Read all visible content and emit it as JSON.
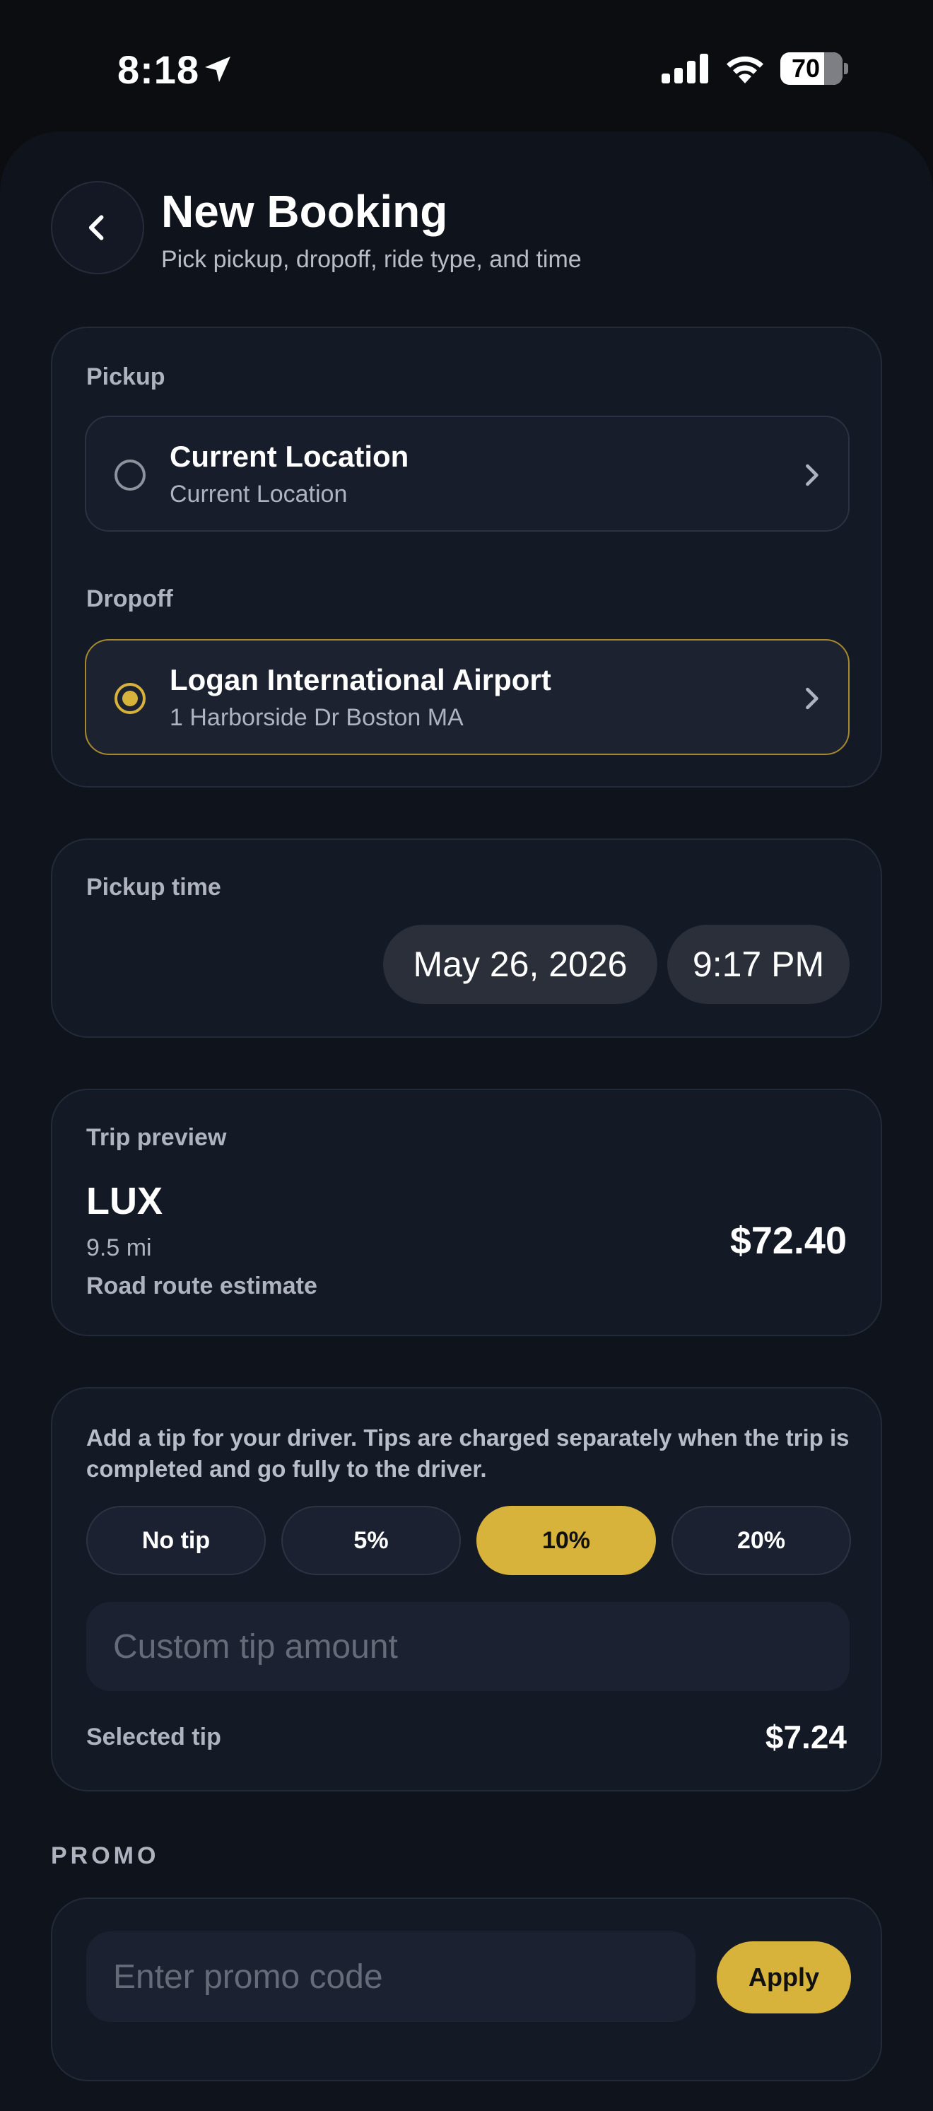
{
  "status_bar": {
    "time": "8:18",
    "battery": "70",
    "icons": [
      "location-arrow-icon",
      "signal-icon",
      "wifi-icon",
      "battery-icon"
    ]
  },
  "header": {
    "title": "New Booking",
    "subtitle": "Pick pickup, dropoff, ride type, and time",
    "back_icon": "chevron-left-icon"
  },
  "locations": {
    "pickup": {
      "label": "Pickup",
      "title": "Current Location",
      "subtitle": "Current Location",
      "selected": false
    },
    "dropoff": {
      "label": "Dropoff",
      "title": "Logan International Airport",
      "subtitle": "1 Harborside Dr Boston MA",
      "selected": true
    }
  },
  "pickup_time": {
    "label": "Pickup time",
    "date": "May 26, 2026",
    "time": "9:17 PM"
  },
  "trip_preview": {
    "label": "Trip preview",
    "ride_type": "LUX",
    "distance": "9.5 mi",
    "note": "Road route estimate",
    "price": "$72.40"
  },
  "tip": {
    "description": "Add a tip for your driver. Tips are charged separately when the trip is completed and go fully to the driver.",
    "options": [
      "No tip",
      "5%",
      "10%",
      "20%"
    ],
    "selected_option": "10%",
    "custom_placeholder": "Custom tip amount",
    "selected_label": "Selected tip",
    "selected_value": "$7.24"
  },
  "promo": {
    "section_title": "PROMO",
    "placeholder": "Enter promo code",
    "apply_label": "Apply"
  },
  "colors": {
    "accent": "#d7b33b",
    "background": "#0b0d11",
    "card": "#131925"
  }
}
